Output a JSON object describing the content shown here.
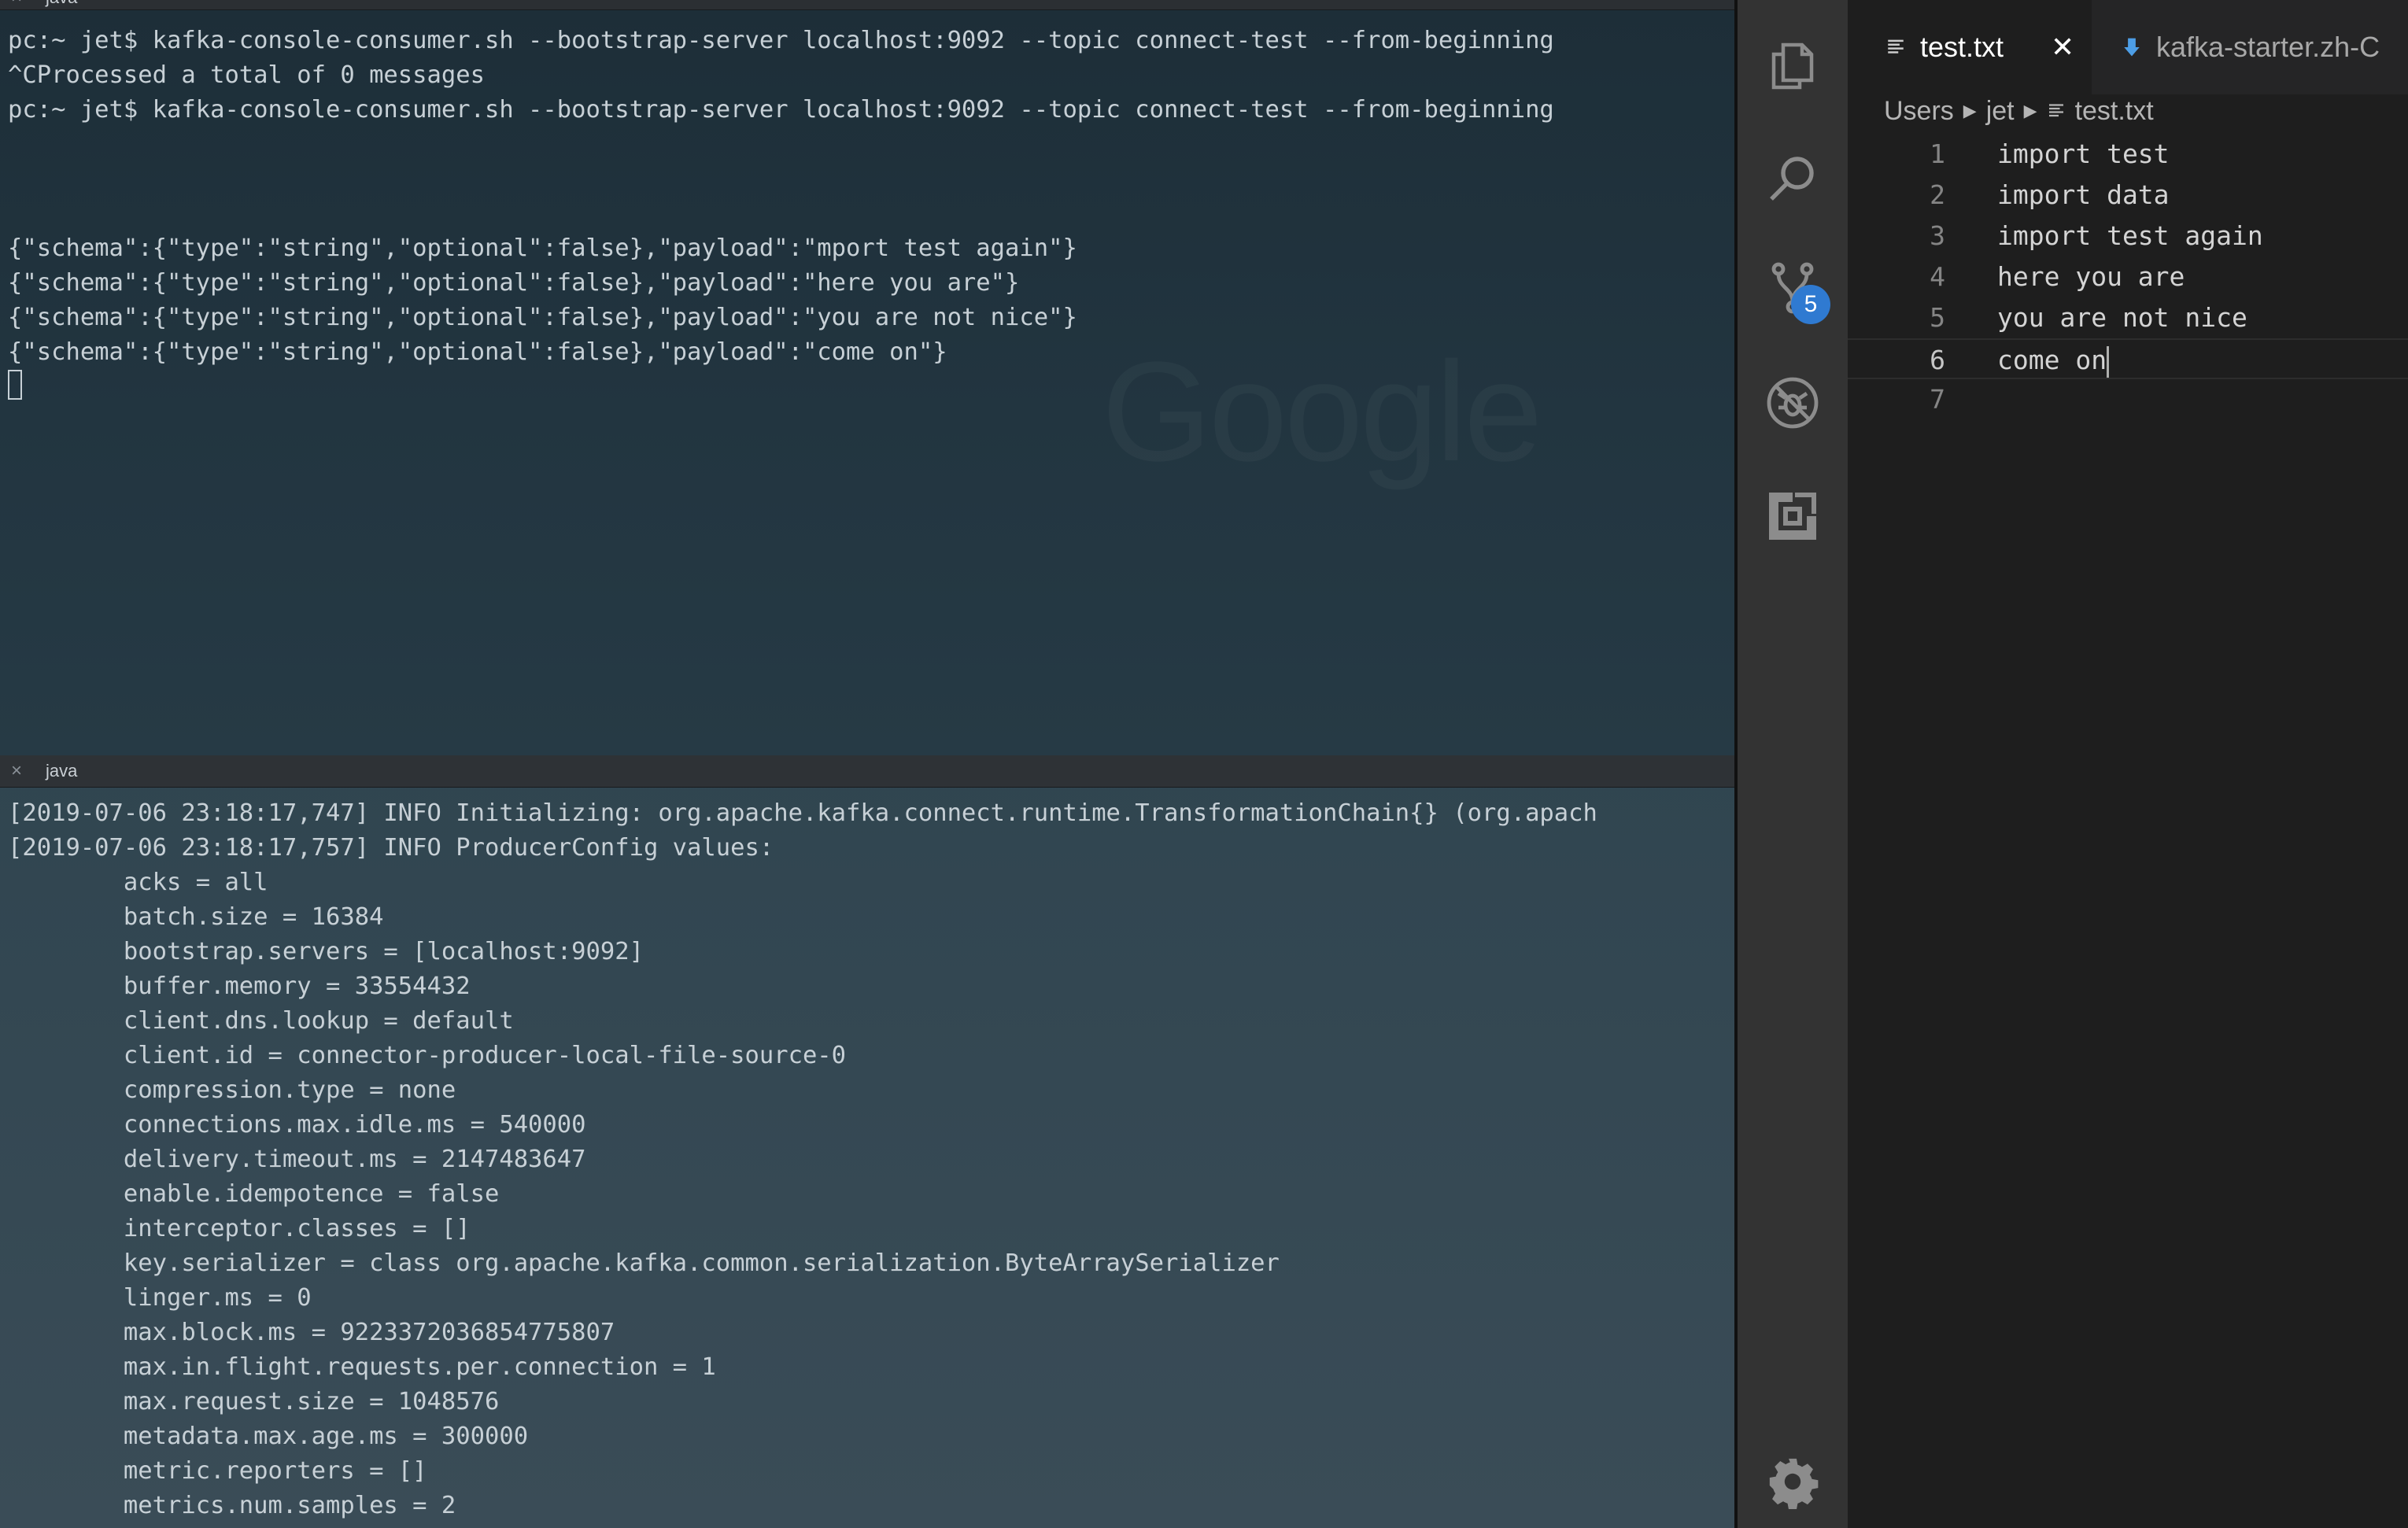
{
  "terminal_top": {
    "tab_title": "java",
    "lines": [
      "pc:~ jet$ kafka-console-consumer.sh --bootstrap-server localhost:9092 --topic connect-test --from-beginning",
      "^CProcessed a total of 0 messages",
      "pc:~ jet$ kafka-console-consumer.sh --bootstrap-server localhost:9092 --topic connect-test --from-beginning",
      "",
      "",
      "",
      "{\"schema\":{\"type\":\"string\",\"optional\":false},\"payload\":\"mport test again\"}",
      "{\"schema\":{\"type\":\"string\",\"optional\":false},\"payload\":\"here you are\"}",
      "{\"schema\":{\"type\":\"string\",\"optional\":false},\"payload\":\"you are not nice\"}",
      "{\"schema\":{\"type\":\"string\",\"optional\":false},\"payload\":\"come on\"}"
    ]
  },
  "terminal_bottom": {
    "tab_title": "java",
    "lines": [
      "[2019-07-06 23:18:17,747] INFO Initializing: org.apache.kafka.connect.runtime.TransformationChain{} (org.apach",
      "[2019-07-06 23:18:17,757] INFO ProducerConfig values:",
      "\tacks = all",
      "\tbatch.size = 16384",
      "\tbootstrap.servers = [localhost:9092]",
      "\tbuffer.memory = 33554432",
      "\tclient.dns.lookup = default",
      "\tclient.id = connector-producer-local-file-source-0",
      "\tcompression.type = none",
      "\tconnections.max.idle.ms = 540000",
      "\tdelivery.timeout.ms = 2147483647",
      "\tenable.idempotence = false",
      "\tinterceptor.classes = []",
      "\tkey.serializer = class org.apache.kafka.common.serialization.ByteArraySerializer",
      "\tlinger.ms = 0",
      "\tmax.block.ms = 9223372036854775807",
      "\tmax.in.flight.requests.per.connection = 1",
      "\tmax.request.size = 1048576",
      "\tmetadata.max.age.ms = 300000",
      "\tmetric.reporters = []",
      "\tmetrics.num.samples = 2"
    ]
  },
  "activity_bar": {
    "items": [
      "files-icon",
      "search-icon",
      "source-control-icon",
      "debug-icon",
      "extensions-icon"
    ],
    "source_control_badge": "5",
    "settings": "gear-icon"
  },
  "editor": {
    "tabs": [
      {
        "label": "test.txt",
        "active": true
      },
      {
        "label": "kafka-starter.zh-C",
        "active": false
      }
    ],
    "breadcrumb": [
      "Users",
      "jet",
      "test.txt"
    ],
    "lines": [
      {
        "n": "1",
        "text": "import test"
      },
      {
        "n": "2",
        "text": "import data"
      },
      {
        "n": "3",
        "text": "import test again"
      },
      {
        "n": "4",
        "text": "here you are"
      },
      {
        "n": "5",
        "text": "you are not nice"
      },
      {
        "n": "6",
        "text": "come on"
      },
      {
        "n": "7",
        "text": ""
      }
    ],
    "current_line": "6"
  }
}
